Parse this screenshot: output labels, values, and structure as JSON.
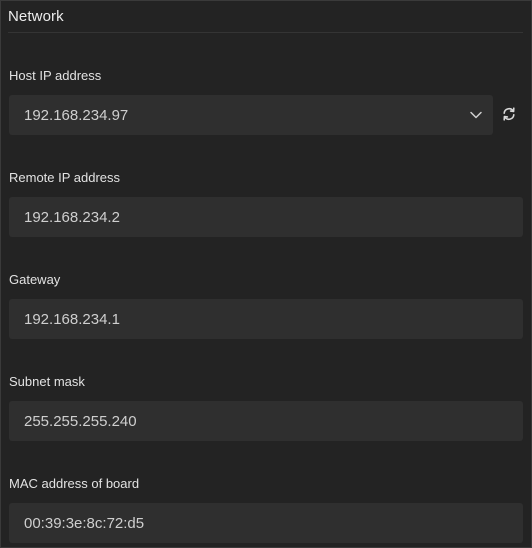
{
  "panel": {
    "title": "Network"
  },
  "fields": {
    "host_ip": {
      "label": "Host IP address",
      "value": "192.168.234.97"
    },
    "remote_ip": {
      "label": "Remote IP address",
      "value": "192.168.234.2"
    },
    "gateway": {
      "label": "Gateway",
      "value": "192.168.234.1"
    },
    "subnet_mask": {
      "label": "Subnet mask",
      "value": "255.255.255.240"
    },
    "mac_address": {
      "label": "MAC address of board",
      "value": "00:39:3e:8c:72:d5"
    }
  },
  "icons": {
    "dropdown": "chevron-down-icon",
    "refresh": "refresh-icon"
  },
  "colors": {
    "background": "#232323",
    "field_background": "#2f2f2f",
    "text": "#e6e6e6"
  }
}
